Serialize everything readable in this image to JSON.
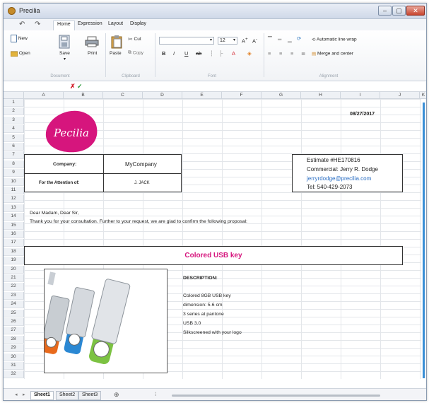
{
  "window": {
    "title": "Precilia"
  },
  "ribbon": {
    "tabs": [
      "Home",
      "Expression",
      "Layout",
      "Display"
    ],
    "home": {
      "new_label": "New",
      "open_label": "Open",
      "save_label": "Save",
      "print_label": "Print",
      "paste_label": "Paste",
      "cut_label": "Cut",
      "copy_label": "Copy",
      "font_name": "",
      "font_size": "12",
      "wrap_label": "Automatic line wrap",
      "merge_label": "Merge and center"
    },
    "groups": [
      "Document",
      "Clipboard",
      "Font",
      "Alignment"
    ]
  },
  "columns": [
    "A",
    "B",
    "C",
    "D",
    "E",
    "F",
    "G",
    "H",
    "I",
    "J",
    "K"
  ],
  "rows": [
    "1",
    "2",
    "3",
    "4",
    "5",
    "6",
    "7",
    "8",
    "9",
    "10",
    "11",
    "12",
    "13",
    "14",
    "15",
    "16",
    "17",
    "18",
    "19",
    "20",
    "21",
    "22",
    "23",
    "24",
    "25",
    "26",
    "27",
    "28",
    "29",
    "30",
    "31",
    "32"
  ],
  "sheet": {
    "date": "08/27/2017",
    "company_label": "Company:",
    "company_value": "MyCompany",
    "attention_label": "For the Attention of:",
    "attention_value": "J. JACK",
    "estimate_line": "Estimate #HE170816",
    "commercial_line": "Commercial: Jerry R. Dodge",
    "email_line": "jerryrdodge@precilia.com",
    "tel_line": "Tel: 540-429-2073",
    "greeting": "Dear Madam, Dear Sir,",
    "intro": "Thank you for your consultation. Further to your request, we are glad to confirm the following proposal:",
    "product_title": "Colored USB key",
    "description_title": "DESCRIPTION:",
    "description_lines": [
      "Colored 8GB USB key",
      "dimension: 5-6 cm",
      "3 series at pantone",
      "USB 3.0",
      "Silkscreened with your logo"
    ],
    "logo_text": "Pecilia"
  },
  "sheet_tabs": [
    "Sheet1",
    "Sheet2",
    "Sheet3"
  ],
  "colors": {
    "accent_pink": "#d6157d",
    "link_blue": "#2b6fc4"
  }
}
